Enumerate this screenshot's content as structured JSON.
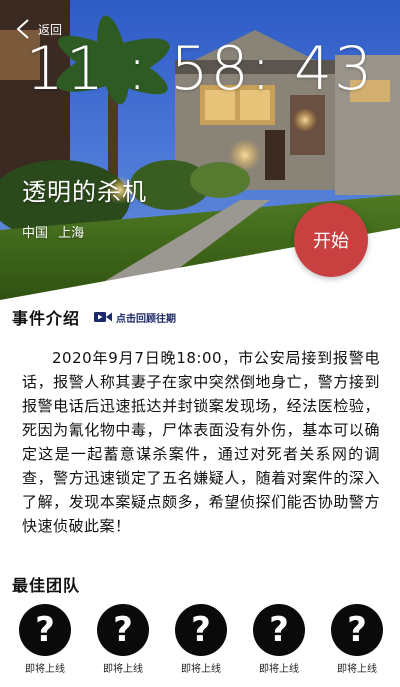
{
  "header": {
    "back_label": "返回"
  },
  "timer": {
    "display": "11 : 58: 43"
  },
  "case": {
    "title": "透明的杀机",
    "location": "中国 上海",
    "start_label": "开始"
  },
  "intro": {
    "heading": "事件介绍",
    "replay_label": "点击回顾往期",
    "description": "2020年9月7日晚18:00，市公安局接到报警电话，报警人称其妻子在家中突然倒地身亡，警方接到报警电话后迅速抵达并封锁案发现场，经法医检验，死因为氰化物中毒，尸体表面没有外伤，基本可以确定这是一起蓄意谋杀案件，通过对死者关系网的调查，警方迅速锁定了五名嫌疑人，随着对案件的深入了解，发现本案疑点颇多，希望侦探们能否协助警方快速侦破此案！"
  },
  "team": {
    "heading": "最佳团队",
    "members": [
      {
        "symbol": "?",
        "label": "即将上线"
      },
      {
        "symbol": "?",
        "label": "即将上线"
      },
      {
        "symbol": "?",
        "label": "即将上线"
      },
      {
        "symbol": "?",
        "label": "即将上线"
      },
      {
        "symbol": "?",
        "label": "即将上线"
      }
    ]
  },
  "colors": {
    "start_button": "#c84040",
    "replay_link": "#1b2a66",
    "avatar": "#0a0a0a"
  }
}
